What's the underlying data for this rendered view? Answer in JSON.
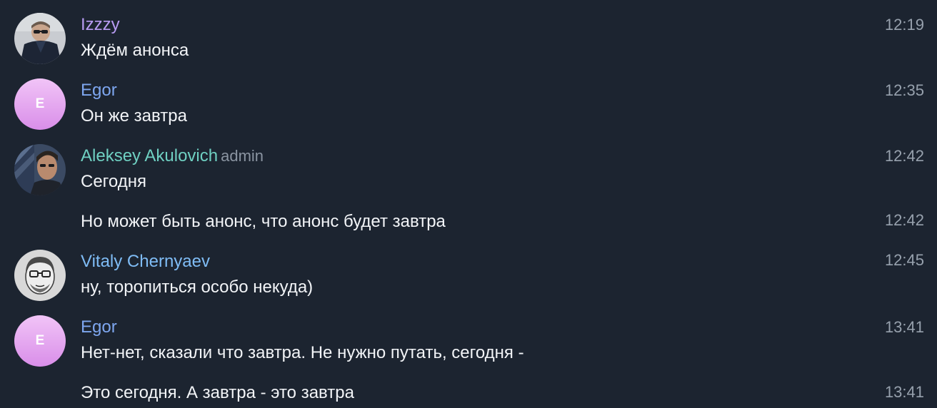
{
  "colors": {
    "background": "#1c2430",
    "izzzy_name": "#b89cf3",
    "egor_name": "#7ea7f0",
    "aleksey_name": "#6fd0c2",
    "vitaly_name": "#7fbcf5",
    "egor_avatar": "#e3a6f0"
  },
  "messages": [
    {
      "author": "Izzzy",
      "role": "",
      "text": "Ждём анонса",
      "time": "12:19",
      "avatar": "photo"
    },
    {
      "author": "Egor",
      "role": "",
      "text": "Он же завтра",
      "time": "12:35",
      "avatar": "letter",
      "avatar_letter": "E"
    },
    {
      "author": "Aleksey Akulovich",
      "role": "admin",
      "text": "Сегодня",
      "time": "12:42",
      "avatar": "photo"
    },
    {
      "author": "",
      "role": "",
      "text": "Но может быть анонс, что анонс будет завтра",
      "time": "12:42"
    },
    {
      "author": "Vitaly Chernyaev",
      "role": "",
      "text": "ну, торопиться особо некуда)",
      "time": "12:45",
      "avatar": "photo"
    },
    {
      "author": "Egor",
      "role": "",
      "text": "Нет-нет, сказали что завтра. Не нужно путать, сегодня -",
      "time": "13:41",
      "avatar": "letter",
      "avatar_letter": "E"
    },
    {
      "author": "",
      "role": "",
      "text": "Это сегодня. А завтра - это завтра",
      "time": "13:41"
    }
  ]
}
